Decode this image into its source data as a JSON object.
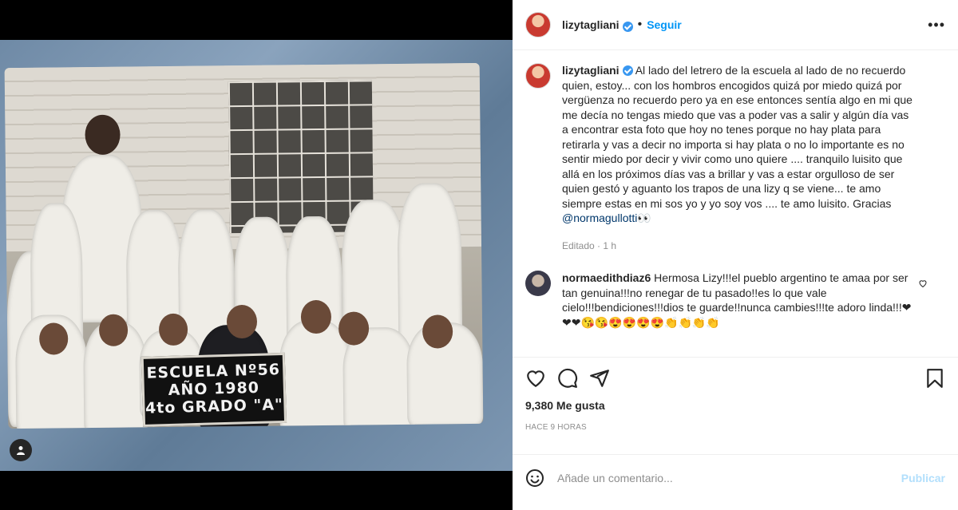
{
  "post": {
    "author": "lizytagliani",
    "follow_label": "Seguir",
    "separator": "•",
    "more_label": "•••",
    "sign": {
      "line1": "ESCUELA Nº56",
      "line2": "AÑO 1980",
      "line3": "4to GRADO \"A\""
    }
  },
  "caption": {
    "author": "lizytagliani",
    "text": "Al lado del letrero de la escuela al lado de no recuerdo quien, estoy... con los hombros encogidos quizá por miedo quizá por vergüenza no recuerdo pero ya en ese entonces sentía algo en mi que me decía no tengas miedo que vas a poder vas a salir y algún día vas a encontrar esta foto que hoy no tenes porque no hay plata para retirarla y vas a decir no importa si hay plata o no lo importante es no sentir miedo por decir y vivir como uno quiere .... tranquilo luisito que allá en los próximos días vas a brillar y vas a estar orgulloso de ser quien gestó y aguanto los trapos de una lizy q se viene... te amo siempre estas en mi sos yo y yo soy vos .... te amo luisito. Gracias",
    "mention": "@normagullotti",
    "emoji": "👀",
    "meta": "Editado · 1 h"
  },
  "comment": {
    "author": "normaedithdiaz6",
    "text": "Hermosa Lizy!!!el pueblo argentino te amaa por ser tan genuina!!!no renegar de tu pasado!!es lo que vale cielo!!!bendiciones!!!dios te guarde!!nunca cambies!!!te adoro linda!!!❤❤❤😘😘😍😍😍😍👏👏👏👏"
  },
  "stats": {
    "likes": "9,380 Me gusta",
    "time": "HACE 9 HORAS"
  },
  "composer": {
    "placeholder": "Añade un comentario...",
    "publish_label": "Publicar"
  },
  "icons": [
    "heart-icon",
    "comment-icon",
    "share-icon",
    "bookmark-icon",
    "emoji-icon",
    "tag-user-icon",
    "more-icon",
    "verified-icon"
  ]
}
